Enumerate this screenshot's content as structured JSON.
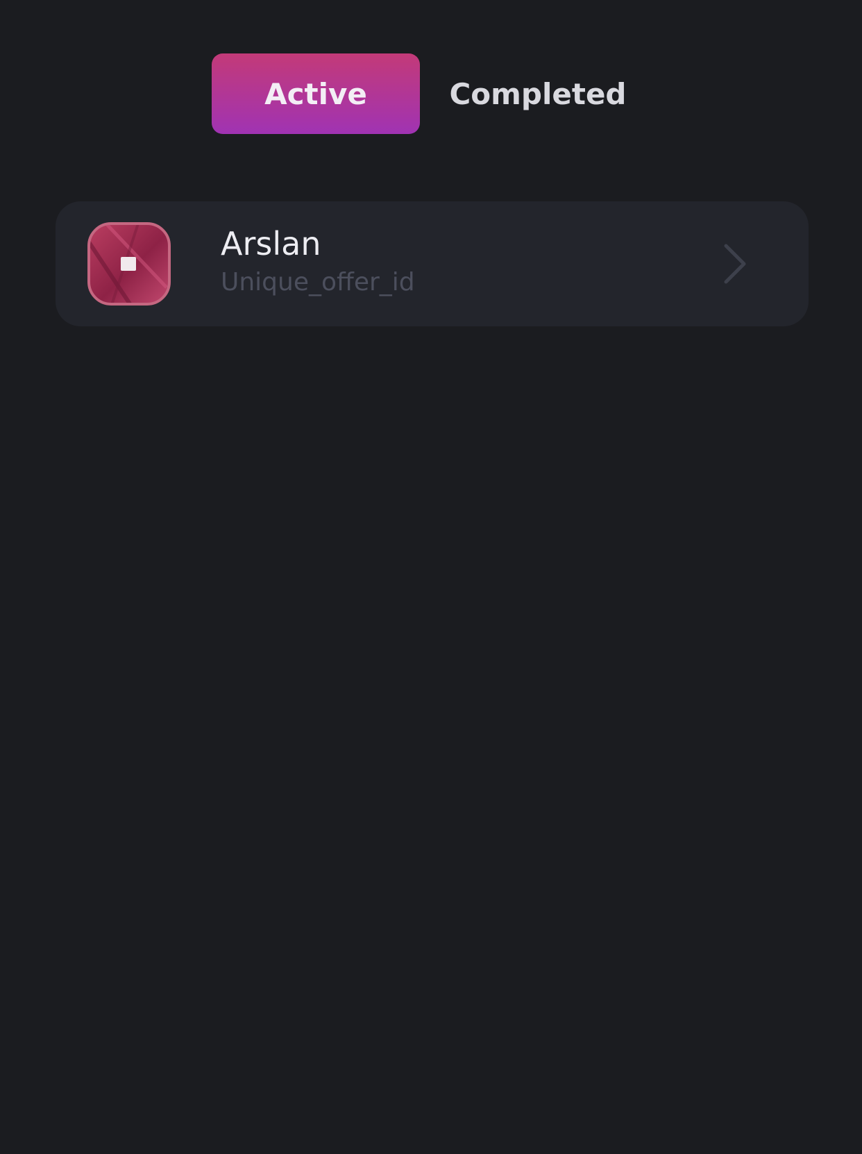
{
  "tabs": {
    "active_label": "Active",
    "completed_label": "Completed",
    "selected": "Active"
  },
  "offers": [
    {
      "name": "Arslan",
      "offer_id": "Unique_offer_id",
      "icon": "offer-app-icon"
    }
  ],
  "icons": {
    "chevron": "chevron-right-icon"
  },
  "colors": {
    "background": "#1b1c20",
    "card_background": "#23252c",
    "active_tab_gradient_start": "#c33a78",
    "active_tab_gradient_end": "#a033b3",
    "secondary_text": "#4c4f5d"
  }
}
